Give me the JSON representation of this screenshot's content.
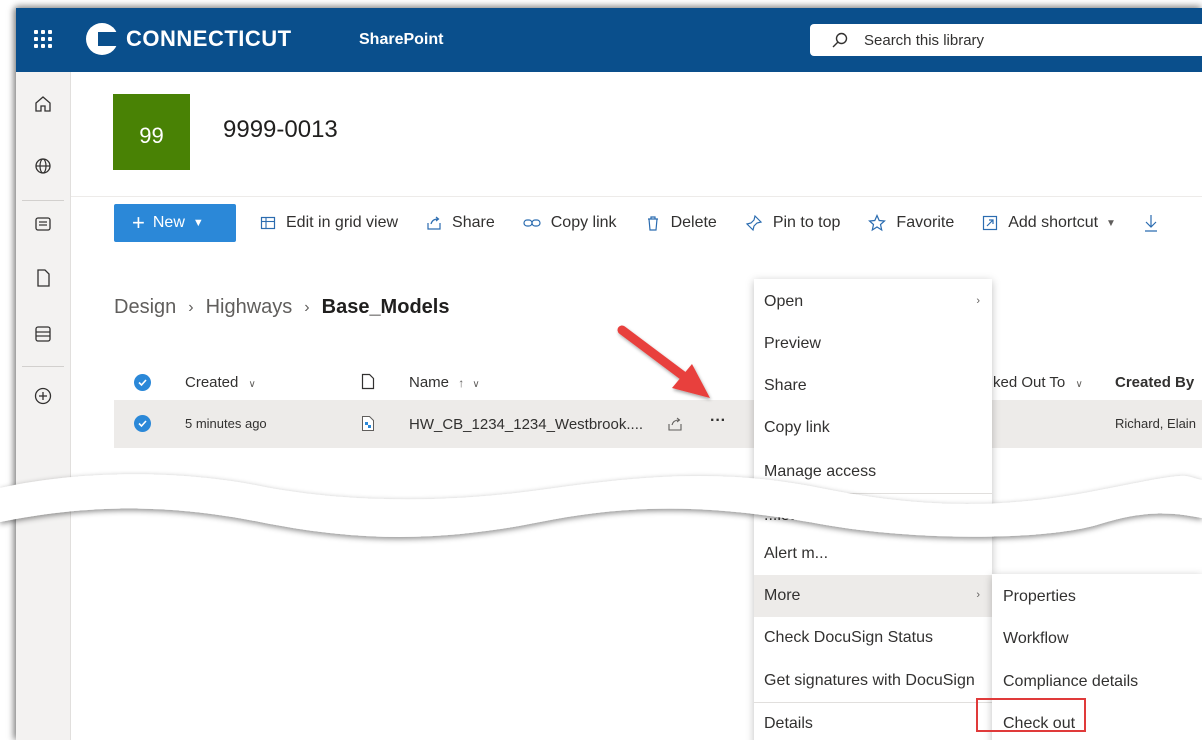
{
  "suite": {
    "org_name": "CONNECTICUT",
    "app_name": "SharePoint",
    "search_placeholder": "Search this library"
  },
  "site": {
    "logo_text": "99",
    "title": "9999-0013"
  },
  "commands": {
    "new_label": "New",
    "edit_grid": "Edit in grid view",
    "share": "Share",
    "copy_link": "Copy link",
    "delete": "Delete",
    "pin_to_top": "Pin to top",
    "favorite": "Favorite",
    "add_shortcut": "Add shortcut"
  },
  "breadcrumb": [
    "Design",
    "Highways",
    "Base_Models"
  ],
  "columns": {
    "created": "Created",
    "name": "Name",
    "checked_out_to": "ked Out To",
    "created_by": "Created By"
  },
  "row": {
    "created": "5 minutes ago",
    "name": "HW_CB_1234_1234_Westbrook....",
    "more": "···",
    "created_by": "Richard, Elain"
  },
  "context_menu": {
    "items": [
      {
        "label": "Open"
      },
      {
        "label": "Preview"
      },
      {
        "label": "Share"
      },
      {
        "label": "Copy link"
      },
      {
        "label": "Manage access"
      },
      {
        "label": "...lete"
      },
      {
        "label": "Alert m..."
      },
      {
        "label": "More"
      },
      {
        "label": "Check DocuSign Status"
      },
      {
        "label": "Get signatures with DocuSign"
      },
      {
        "label": "Details"
      }
    ]
  },
  "submenu": {
    "items": [
      {
        "label": "Properties"
      },
      {
        "label": "Workflow"
      },
      {
        "label": "Compliance details"
      },
      {
        "label": "Check out"
      }
    ]
  },
  "colors": {
    "suite_bar": "#0a4f8c",
    "accent": "#2b88d8",
    "site_logo": "#498205",
    "highlight_box": "#e03a3a",
    "arrow": "#e8413d"
  }
}
